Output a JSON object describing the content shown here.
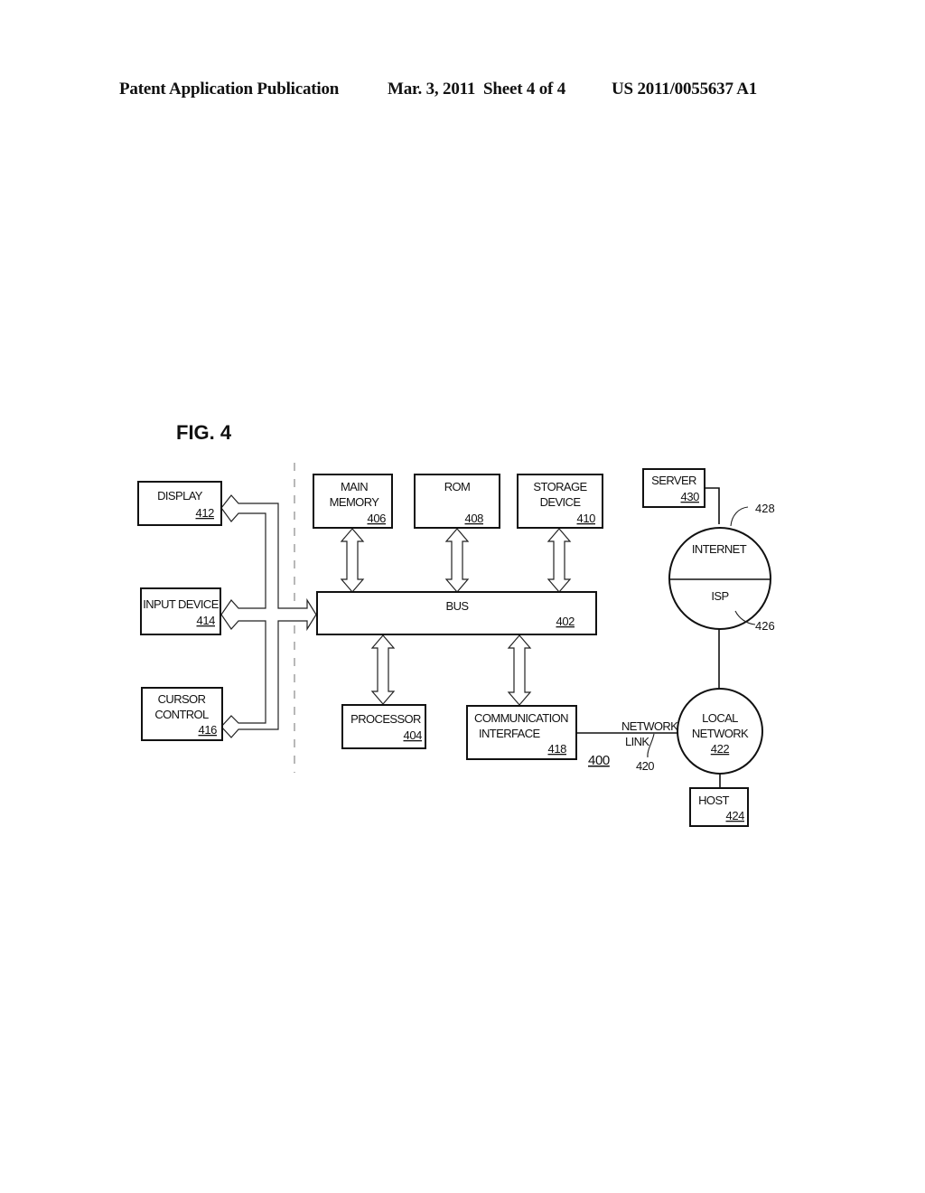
{
  "header": {
    "publication": "Patent Application Publication",
    "date": "Mar. 3, 2011",
    "sheet": "Sheet 4 of 4",
    "number": "US 2011/0055637 A1"
  },
  "figure": {
    "title": "FIG. 4",
    "system_ref": "400",
    "blocks": {
      "display": {
        "label": [
          "DISPLAY"
        ],
        "ref": "412"
      },
      "input_device": {
        "label": [
          "INPUT DEVICE"
        ],
        "ref": "414"
      },
      "cursor_control": {
        "label": [
          "CURSOR",
          "CONTROL"
        ],
        "ref": "416"
      },
      "main_memory": {
        "label": [
          "MAIN",
          "MEMORY"
        ],
        "ref": "406"
      },
      "rom": {
        "label": [
          "ROM"
        ],
        "ref": "408"
      },
      "storage_device": {
        "label": [
          "STORAGE",
          "DEVICE"
        ],
        "ref": "410"
      },
      "bus": {
        "label": [
          "BUS"
        ],
        "ref": "402"
      },
      "processor": {
        "label": [
          "PROCESSOR"
        ],
        "ref": "404"
      },
      "communication_interface": {
        "label": [
          "COMMUNICATION",
          "INTERFACE"
        ],
        "ref": "418"
      },
      "server": {
        "label": [
          "SERVER"
        ],
        "ref": "430"
      },
      "host": {
        "label": [
          "HOST"
        ],
        "ref": "424"
      }
    },
    "internet": {
      "label": "INTERNET",
      "ref": "428"
    },
    "isp": {
      "label": "ISP",
      "ref": "426"
    },
    "local_network": {
      "label": [
        "LOCAL",
        "NETWORK"
      ],
      "ref": "422"
    },
    "network_link": {
      "label": [
        "NETWORK",
        "LINK"
      ],
      "ref": "420"
    }
  }
}
